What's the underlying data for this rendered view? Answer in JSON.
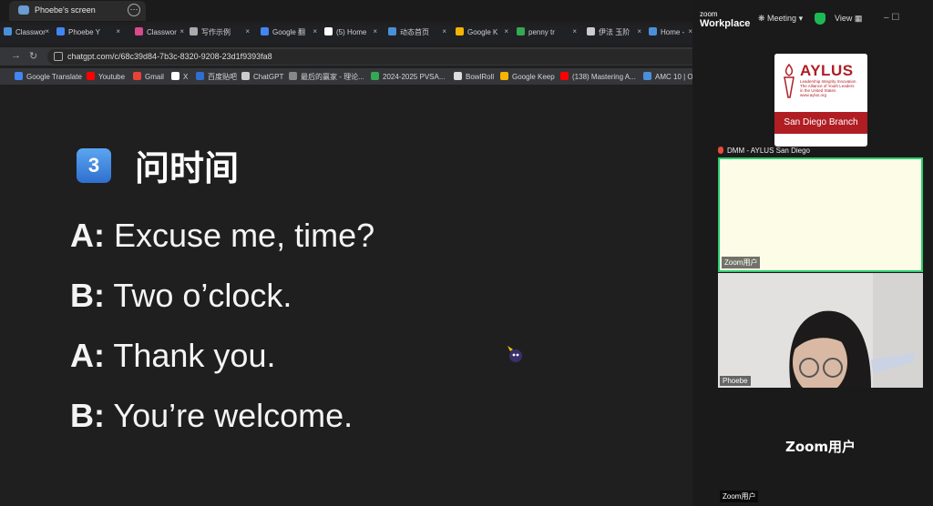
{
  "shared_window": {
    "tab_title": "Phoebe's screen",
    "more_glyph": "⋯"
  },
  "browser": {
    "tabs": [
      {
        "label": "Classwor",
        "color": "#4a90d9"
      },
      {
        "label": "Phoebe Y",
        "color": "#4285f4"
      },
      {
        "label": "Classwor",
        "color": "#d94a8c"
      },
      {
        "label": "写作示例",
        "color": "#aaaaaa"
      },
      {
        "label": "Google 翻",
        "color": "#4285f4"
      },
      {
        "label": "(5) Home",
        "color": "#ffffff"
      },
      {
        "label": "动态首页",
        "color": "#4a90d9"
      },
      {
        "label": "Google K",
        "color": "#f4b400"
      },
      {
        "label": "penny tr",
        "color": "#34a853"
      },
      {
        "label": "伊法 玉阶",
        "color": "#cccccc"
      },
      {
        "label": "Home -",
        "color": "#4a90d9"
      }
    ],
    "close_glyph": "×",
    "nav": {
      "forward": "→",
      "reload": "↻"
    },
    "url": "chatgpt.com/c/68c39d84-7b3c-8320-9208-23d1f9393fa8",
    "bookmarks": [
      {
        "label": "Google Translate",
        "color": "#4285f4"
      },
      {
        "label": "Youtube",
        "color": "#ff0000"
      },
      {
        "label": "Gmail",
        "color": "#ea4335"
      },
      {
        "label": "X",
        "color": "#ffffff"
      },
      {
        "label": "百度贴吧",
        "color": "#2f6fd0"
      },
      {
        "label": "ChatGPT",
        "color": "#cccccc"
      },
      {
        "label": "最后的赢家 - 理论...",
        "color": "#888888"
      },
      {
        "label": "2024-2025 PVSA...",
        "color": "#34a853"
      },
      {
        "label": "BowlRoll",
        "color": "#dddddd"
      },
      {
        "label": "Google Keep",
        "color": "#f4b400"
      },
      {
        "label": "(138) Mastering A...",
        "color": "#ff0000"
      },
      {
        "label": "AMC 10 | Or",
        "color": "#4a90d9"
      }
    ]
  },
  "lesson": {
    "badge": "3",
    "title": "问时间",
    "lines": [
      {
        "speaker": "A:",
        "text": "Excuse me, time?"
      },
      {
        "speaker": "B:",
        "text": "Two o’clock."
      },
      {
        "speaker": "A:",
        "text": "Thank you."
      },
      {
        "speaker": "B:",
        "text": "You’re welcome."
      }
    ]
  },
  "zoom": {
    "logo_line1": "zoom",
    "logo_line2": "Workplace",
    "meeting_label": "Meeting",
    "view_label": "View",
    "window_controls": "–   ☐",
    "host_logo": {
      "brand": "AYLUS",
      "tagline_1": "Leadership Integrity Innovation",
      "tagline_2": "The Alliance of Youth Leaders",
      "tagline_3": "in the United States",
      "tagline_4": "www.aylus.org",
      "branch": "San Diego Branch"
    },
    "host_name": "DMM - AYLUS San Diego",
    "tiles": [
      {
        "label": "Zoom用户"
      },
      {
        "label": "Phoebe"
      }
    ],
    "bottom_tile": {
      "name": "Zoom用户",
      "label": "Zoom用户"
    }
  }
}
